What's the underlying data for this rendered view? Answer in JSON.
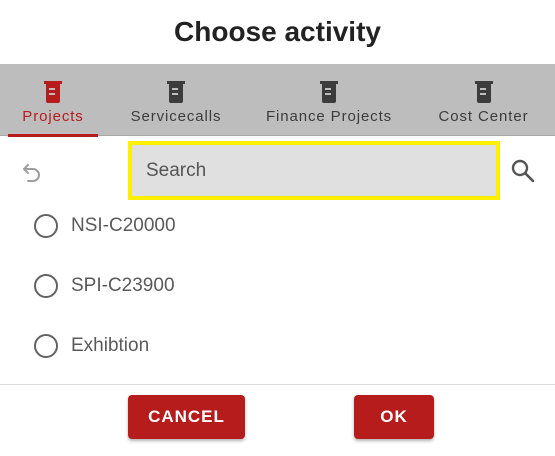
{
  "dialog": {
    "title": "Choose activity"
  },
  "tabs": [
    {
      "label": "Projects",
      "icon": "beaker-icon",
      "active": true
    },
    {
      "label": "Servicecalls",
      "icon": "beaker-icon",
      "active": false
    },
    {
      "label": "Finance Projects",
      "icon": "beaker-icon",
      "active": false
    },
    {
      "label": "Cost Center",
      "icon": "beaker-icon",
      "active": false
    }
  ],
  "search": {
    "placeholder": "Search",
    "value": ""
  },
  "options": [
    {
      "label": "NSI-C20000",
      "selected": false
    },
    {
      "label": "SPI-C23900",
      "selected": false
    },
    {
      "label": "Exhibtion",
      "selected": false
    }
  ],
  "buttons": {
    "cancel": "CANCEL",
    "ok": "OK"
  },
  "colors": {
    "accent": "#b71c1c",
    "tabbar": "#bdbdbd",
    "search_highlight": "#ffef00",
    "search_bg": "#e0e0e0",
    "icon_inactive": "#3c3c3c"
  }
}
